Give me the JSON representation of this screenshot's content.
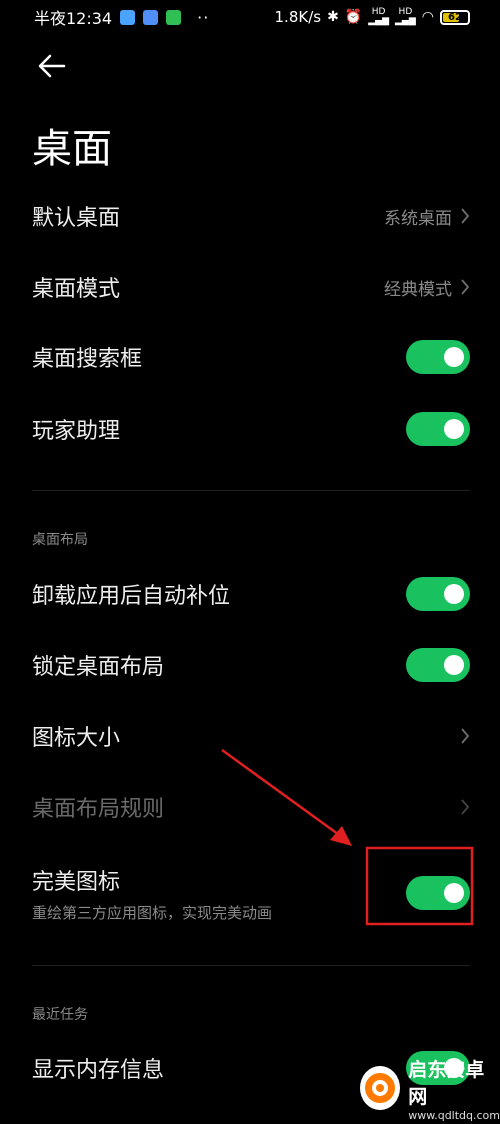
{
  "status_bar": {
    "time": "半夜12:34",
    "more": "··",
    "net_speed": "1.8K/s",
    "signal1": "HD",
    "signal2": "HD",
    "battery": "62"
  },
  "header": {
    "title": "桌面"
  },
  "rows": {
    "default_desktop": {
      "label": "默认桌面",
      "value": "系统桌面"
    },
    "desktop_mode": {
      "label": "桌面模式",
      "value": "经典模式"
    },
    "search_box": {
      "label": "桌面搜索框",
      "on": true
    },
    "game_assistant": {
      "label": "玩家助理",
      "on": true
    }
  },
  "layout_section": {
    "title": "桌面布局",
    "auto_fill": {
      "label": "卸载应用后自动补位",
      "on": true
    },
    "lock_layout": {
      "label": "锁定桌面布局",
      "on": true
    },
    "icon_size": {
      "label": "图标大小"
    },
    "layout_rules": {
      "label": "桌面布局规则"
    },
    "perfect_icons": {
      "label": "完美图标",
      "sublabel": "重绘第三方应用图标，实现完美动画",
      "on": true
    }
  },
  "recent_section": {
    "title": "最近任务",
    "show_memory": {
      "label": "显示内存信息",
      "on": true
    }
  },
  "watermark": {
    "title": "启东安卓网",
    "url": "www.qdltdq.com"
  },
  "colors": {
    "toggle_on": "#1ac15f",
    "annotation": "#e02020",
    "background": "#000000"
  }
}
